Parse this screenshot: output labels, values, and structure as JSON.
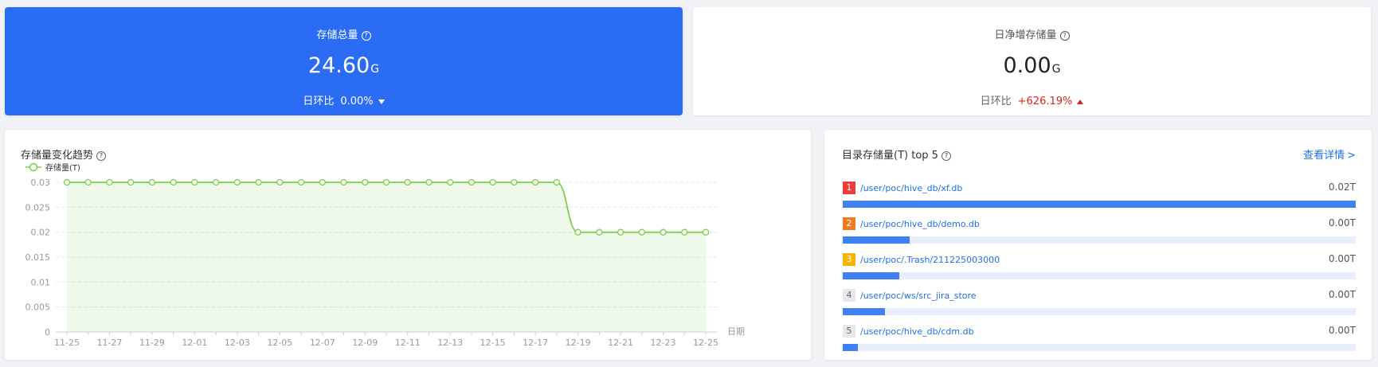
{
  "kpi_total": {
    "title": "存储总量",
    "help": "?",
    "value": "24.60",
    "unit": "G",
    "ratio_label": "日环比",
    "ratio_value": "0.00%",
    "color": "#2a6df4"
  },
  "kpi_daily": {
    "title": "日净增存储量",
    "help": "?",
    "value": "0.00",
    "unit": "G",
    "ratio_label": "日环比",
    "ratio_value": "+626.19%",
    "ratio_color": "#e02020"
  },
  "trend_panel": {
    "title": "存储量变化趋势",
    "help": "?"
  },
  "top_panel": {
    "title": "目录存储量(T) top 5",
    "help": "?",
    "detail_link": "查看详情",
    "detail_arrow": ">"
  },
  "top5": [
    {
      "rank": "1",
      "path": "/user/poc/hive_db/xf.db",
      "value": "0.02T",
      "fraction": 1.0,
      "badge_color": "#f03b3b"
    },
    {
      "rank": "2",
      "path": "/user/poc/hive_db/demo.db",
      "value": "0.00T",
      "fraction": 0.13,
      "badge_color": "#f07a1f"
    },
    {
      "rank": "3",
      "path": "/user/poc/.Trash/211225003000",
      "value": "0.00T",
      "fraction": 0.11,
      "badge_color": "#f5b400"
    },
    {
      "rank": "4",
      "path": "/user/poc/ws/src_jira_store",
      "value": "0.00T",
      "fraction": 0.083,
      "badge_color": "#e6e8ee"
    },
    {
      "rank": "5",
      "path": "/user/poc/hive_db/cdm.db",
      "value": "0.00T",
      "fraction": 0.03,
      "badge_color": "#e6e8ee"
    }
  ],
  "chart_data": {
    "type": "area",
    "series": [
      {
        "name": "存储量(T)",
        "color": "#7ccf4a"
      }
    ],
    "x": [
      "11-25",
      "11-26",
      "11-27",
      "11-28",
      "11-29",
      "11-30",
      "12-01",
      "12-02",
      "12-03",
      "12-04",
      "12-05",
      "12-06",
      "12-07",
      "12-08",
      "12-09",
      "12-10",
      "12-11",
      "12-12",
      "12-13",
      "12-14",
      "12-15",
      "12-16",
      "12-17",
      "12-18",
      "12-19",
      "12-20",
      "12-21",
      "12-22",
      "12-23",
      "12-24",
      "12-25"
    ],
    "y": [
      0.03,
      0.03,
      0.03,
      0.03,
      0.03,
      0.03,
      0.03,
      0.03,
      0.03,
      0.03,
      0.03,
      0.03,
      0.03,
      0.03,
      0.03,
      0.03,
      0.03,
      0.03,
      0.03,
      0.03,
      0.03,
      0.03,
      0.03,
      0.03,
      0.02,
      0.02,
      0.02,
      0.02,
      0.02,
      0.02,
      0.02
    ],
    "x_tick_labels": [
      "11-25",
      "11-27",
      "11-29",
      "12-01",
      "12-03",
      "12-05",
      "12-07",
      "12-09",
      "12-11",
      "12-13",
      "12-15",
      "12-17",
      "12-19",
      "12-21",
      "12-23",
      "12-25"
    ],
    "y_tick_labels": [
      "0",
      "0.005",
      "0.01",
      "0.015",
      "0.02",
      "0.025",
      "0.03"
    ],
    "xlabel": "日期",
    "ylim": [
      0,
      0.03
    ],
    "grid": true,
    "legend": "top-left"
  }
}
